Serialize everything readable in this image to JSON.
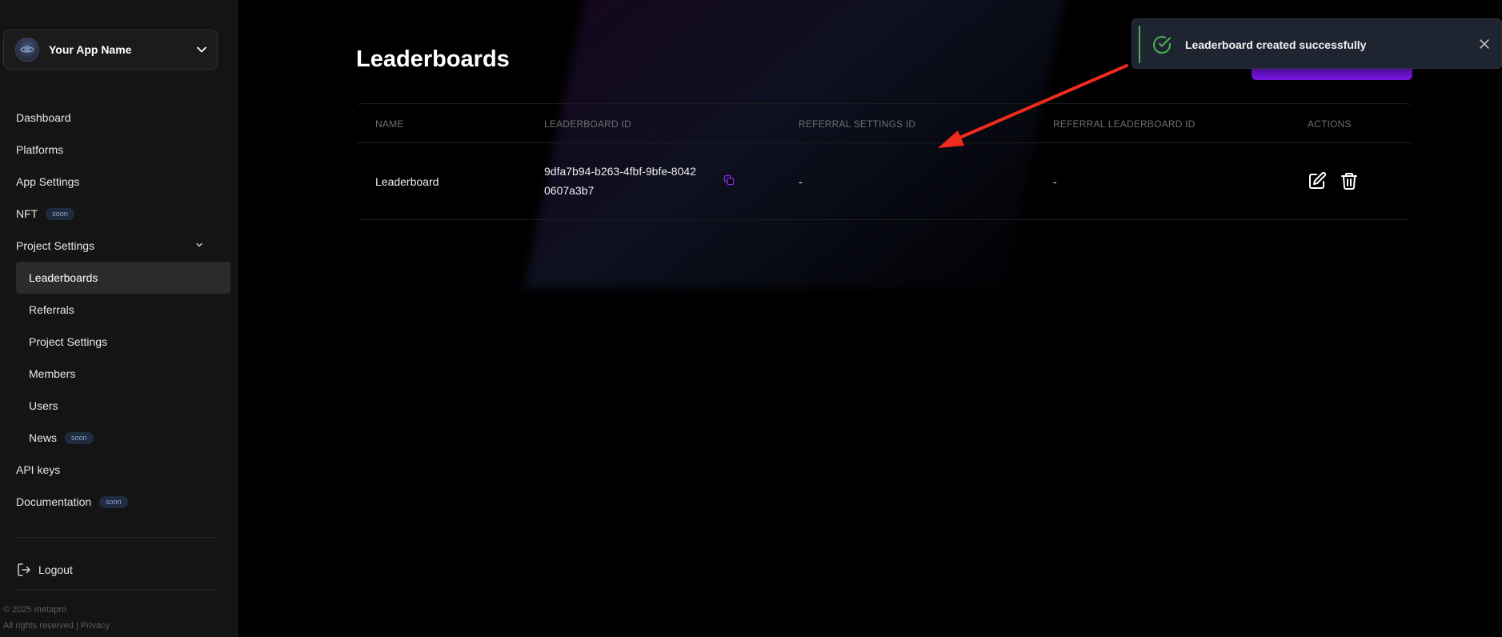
{
  "sidebar": {
    "app_name": "Your App Name",
    "nav": {
      "dashboard": "Dashboard",
      "platforms": "Platforms",
      "app_settings": "App Settings",
      "nft": "NFT",
      "nft_badge": "soon",
      "project_settings": "Project Settings",
      "sub": {
        "leaderboards": "Leaderboards",
        "referrals": "Referrals",
        "project_settings": "Project Settings",
        "members": "Members",
        "users": "Users",
        "news": "News",
        "news_badge": "soon"
      },
      "api_keys": "API keys",
      "documentation": "Documentation",
      "documentation_badge": "soon"
    },
    "logout": "Logout",
    "footer_line1": "© 2025 metapro",
    "footer_line2": "All rights reserved | Privacy",
    "active_item": "Leaderboards"
  },
  "main": {
    "title": "Leaderboards",
    "table": {
      "headers": {
        "name": "NAME",
        "leaderboard_id": "LEADERBOARD ID",
        "referral_settings_id": "REFERRAL SETTINGS ID",
        "referral_leaderboard_id": "REFERRAL LEADERBOARD ID",
        "actions": "ACTIONS"
      },
      "rows": [
        {
          "name": "Leaderboard",
          "leaderboard_id": "9dfa7b94-b263-4fbf-9bfe-80420607a3b7",
          "leaderboard_id_line1": "9dfa7b94-b263-4fbf-9bfe-8042",
          "leaderboard_id_line2": "0607a3b7",
          "referral_settings_id": "-",
          "referral_leaderboard_id": "-"
        }
      ]
    }
  },
  "toast": {
    "message": "Leaderboard created successfully",
    "status": "success"
  },
  "colors": {
    "accent": "#7b17e8",
    "success": "#4caf50",
    "annotation_arrow": "#f02b1d",
    "sidebar_bg": "#141414",
    "background": "#000000"
  },
  "icons": {
    "app_avatar": "planet-avatar-icon",
    "selector": "chevron-down-icon",
    "logout": "logout-icon",
    "copy": "copy-icon",
    "edit": "edit-icon",
    "delete": "trash-icon",
    "toast_status": "check-circle-icon",
    "toast_close": "close-icon"
  }
}
